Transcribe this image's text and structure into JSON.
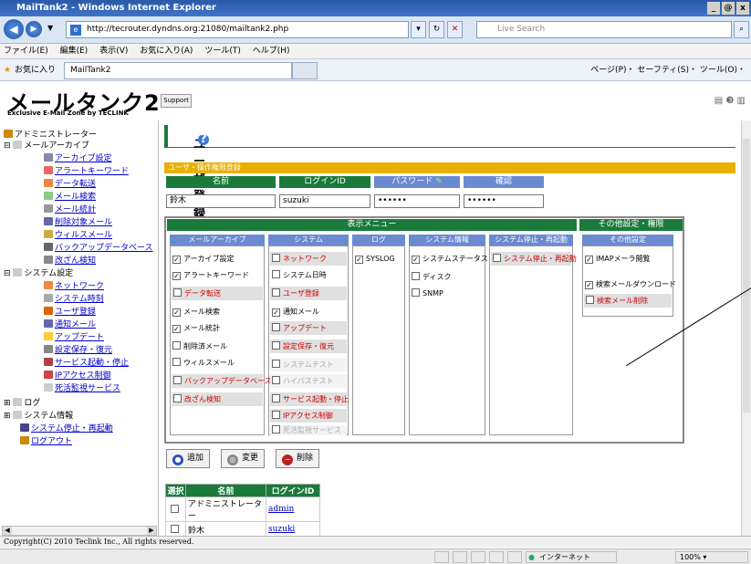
{
  "window": {
    "title": "MailTank2 - Windows Internet Explorer",
    "buttons": [
      "_",
      "@",
      "x"
    ]
  },
  "browser": {
    "address": "http://tecrouter.dyndns.org:21080/mailtank2.php",
    "search_placeholder": "Live Search",
    "menus": [
      "ファイル(E)",
      "編集(E)",
      "表示(V)",
      "お気に入り(A)",
      "ツール(T)",
      "ヘルプ(H)"
    ],
    "favorites": "お気に入り",
    "tab": "MailTank2",
    "toolbar_right": "ページ(P)・ セーフティ(S)・ ツール(O)・"
  },
  "header": {
    "logo": "メールタンク2",
    "logo_sub": "Exclusive E-Mail Zone by TECLINK",
    "support": "Support"
  },
  "sidebar": {
    "items": [
      "アドミニストレーター",
      "メールアーカイブ",
      "アーカイブ設定",
      "アラートキーワード",
      "データ転送",
      "メール検索",
      "メール統計",
      "削除対象メール",
      "ウィルスメール",
      "バックアップデータベース",
      "改ざん検知",
      "システム設定",
      "ネットワーク",
      "システム時刻",
      "ユーザ登録",
      "通知メール",
      "アップデート",
      "設定保存・復元",
      "サービス起動・停止",
      "IPアクセス制御",
      "死活監視サービス",
      "ログ",
      "システム情報",
      "システム停止・再起動",
      "ログアウト"
    ]
  },
  "page": {
    "title": "ユーザ登録",
    "section": "ユーザ・操作権限登録",
    "col_name": "名前",
    "col_login": "ログインID",
    "col_password": "パスワード",
    "col_confirm": "確認",
    "name_value": "鈴木",
    "login_value": "suzuki",
    "password_value": "••••••",
    "confirm_value": "••••••"
  },
  "panel": {
    "display_menu": "表示メニュー",
    "other_settings": "その他設定・権限",
    "subheads": [
      "メールアーカイブ",
      "システム",
      "ログ",
      "システム情報",
      "システム停止・再起動",
      "その他設定"
    ],
    "archive": [
      {
        "label": "アーカイブ設定",
        "checked": true
      },
      {
        "label": "アラートキーワード",
        "checked": true
      },
      {
        "label": "データ転送",
        "checked": false
      },
      {
        "label": "メール検索",
        "checked": true
      },
      {
        "label": "メール統計",
        "checked": true
      },
      {
        "label": "削除済メール",
        "checked": false
      },
      {
        "label": "ウィルスメール",
        "checked": false
      },
      {
        "label": "バックアップデータベース",
        "checked": false
      },
      {
        "label": "改ざん検知",
        "checked": false
      }
    ],
    "system": [
      {
        "label": "ネットワーク",
        "checked": false
      },
      {
        "label": "システム日時",
        "checked": false
      },
      {
        "label": "ユーザ登録",
        "checked": false
      },
      {
        "label": "通知メール",
        "checked": true
      },
      {
        "label": "アップデート",
        "checked": false
      },
      {
        "label": "設定保存・復元",
        "checked": false
      },
      {
        "label": "システムテスト",
        "checked": false
      },
      {
        "label": "ハイパステスト",
        "checked": false
      },
      {
        "label": "サービス起動・停止",
        "checked": false
      },
      {
        "label": "IPアクセス制御",
        "checked": false
      },
      {
        "label": "死活監視サービス",
        "checked": false
      }
    ],
    "log": [
      {
        "label": "SYSLOG",
        "checked": true
      }
    ],
    "sysinfo": [
      {
        "label": "システムステータス",
        "checked": true
      },
      {
        "label": "ディスク",
        "checked": false
      },
      {
        "label": "SNMP",
        "checked": false
      }
    ],
    "stop": [
      {
        "label": "システム停止・再起動",
        "checked": false
      }
    ],
    "other": [
      {
        "label": "IMAPメーラ閲覧",
        "checked": true
      },
      {
        "label": "検索メールダウンロード",
        "checked": true
      },
      {
        "label": "検索メール削除",
        "checked": false
      }
    ]
  },
  "actions": {
    "add": "追加",
    "change": "変更",
    "delete": "削除"
  },
  "list": {
    "headers": [
      "選択",
      "名前",
      "ログインID"
    ],
    "rows": [
      {
        "name": "アドミニストレーター",
        "login": "admin"
      },
      {
        "name": "鈴木",
        "login": "suzuki"
      }
    ]
  },
  "status": {
    "copyright": "Copyright(C) 2010 Teclink Inc., All rights reserved.",
    "zone": "インターネット",
    "zoom": "100%"
  }
}
